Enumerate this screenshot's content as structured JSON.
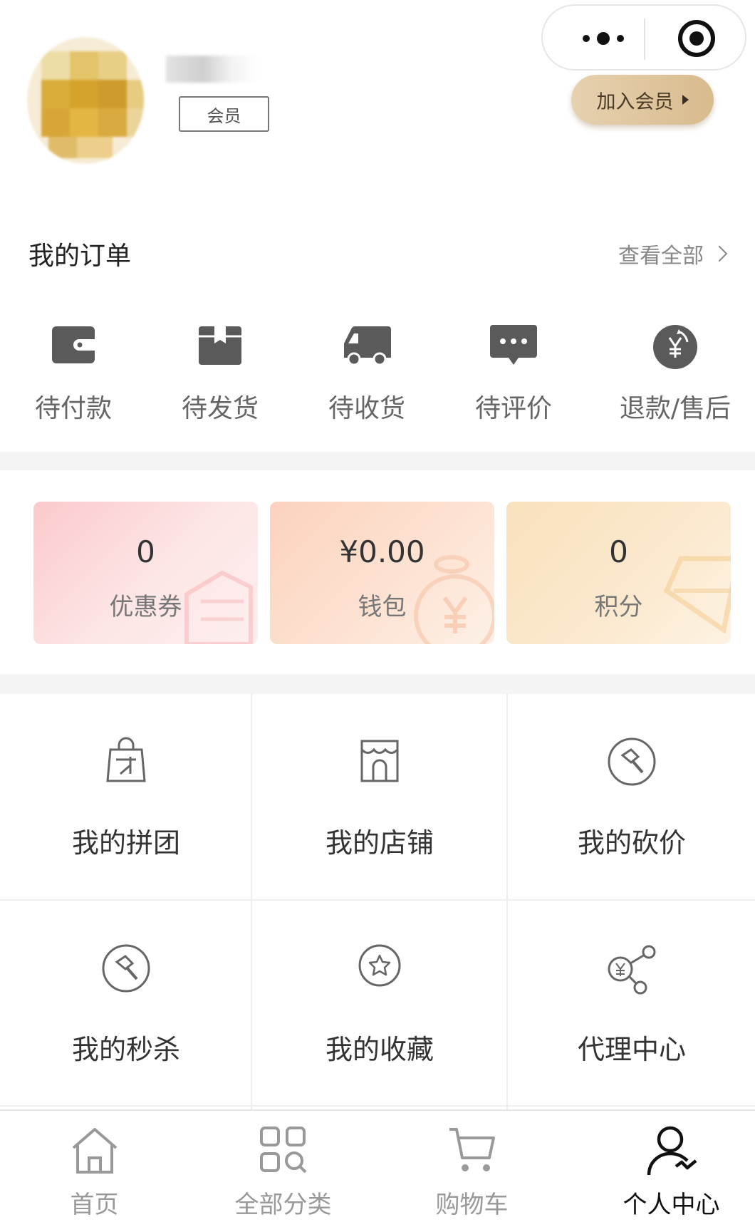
{
  "header": {
    "member_badge": "会员",
    "join_member": "加入会员"
  },
  "orders": {
    "title": "我的订单",
    "view_all": "查看全部",
    "items": [
      {
        "label": "待付款",
        "icon": "wallet-icon"
      },
      {
        "label": "待发货",
        "icon": "package-icon"
      },
      {
        "label": "待收货",
        "icon": "truck-icon"
      },
      {
        "label": "待评价",
        "icon": "comment-icon"
      },
      {
        "label": "退款/售后",
        "icon": "refund-icon"
      }
    ]
  },
  "assets": [
    {
      "value": "0",
      "label": "优惠券",
      "icon": "coupon-icon"
    },
    {
      "value": "¥0.00",
      "label": "钱包",
      "icon": "money-bag-icon"
    },
    {
      "value": "0",
      "label": "积分",
      "icon": "diamond-icon"
    }
  ],
  "menu": [
    {
      "label": "我的拼团",
      "icon": "group-buy-bag-icon"
    },
    {
      "label": "我的店铺",
      "icon": "store-icon"
    },
    {
      "label": "我的砍价",
      "icon": "bargain-axe-icon"
    },
    {
      "label": "我的秒杀",
      "icon": "flash-sale-icon"
    },
    {
      "label": "我的收藏",
      "icon": "star-icon"
    },
    {
      "label": "代理中心",
      "icon": "agent-network-icon"
    }
  ],
  "tabbar": [
    {
      "label": "首页",
      "icon": "home-icon",
      "active": false
    },
    {
      "label": "全部分类",
      "icon": "category-icon",
      "active": false
    },
    {
      "label": "购物车",
      "icon": "cart-icon",
      "active": false
    },
    {
      "label": "个人中心",
      "icon": "user-icon",
      "active": true
    }
  ],
  "colors": {
    "accent_gold": "#d8bb8d",
    "icon_gray": "#5a5a5a",
    "card_coupon": "#fbc9cc",
    "card_wallet": "#fbd2bd",
    "card_points": "#f9e1bd"
  }
}
